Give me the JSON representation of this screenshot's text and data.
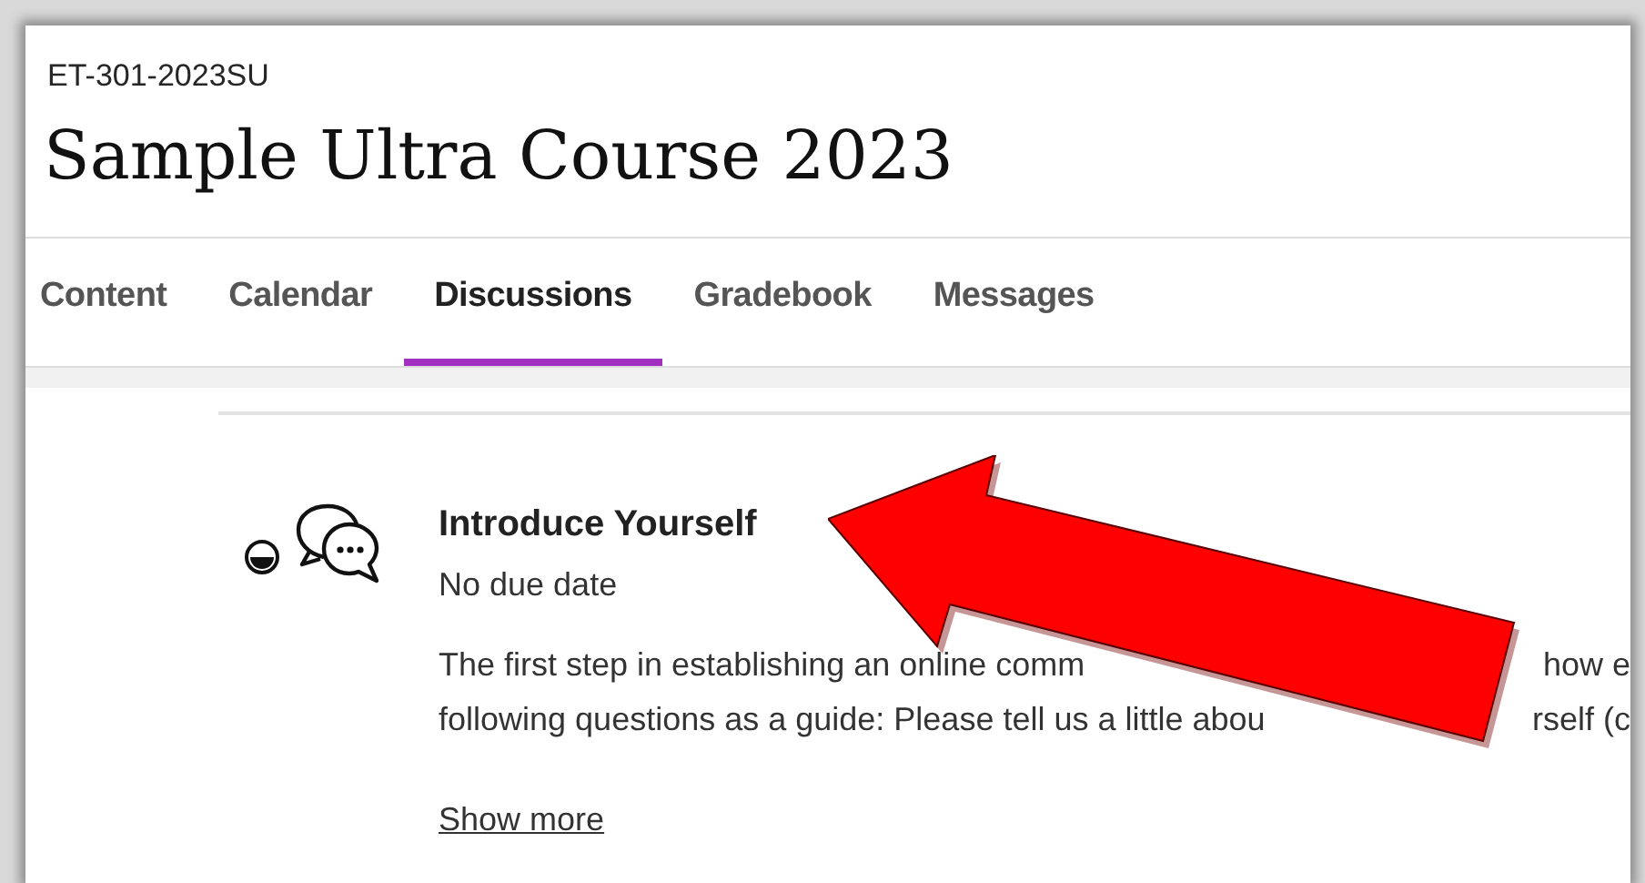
{
  "course_code": "ET-301-2023SU",
  "course_title": "Sample Ultra Course 2023",
  "tabs": [
    {
      "label": "Content",
      "selected": false
    },
    {
      "label": "Calendar",
      "selected": false
    },
    {
      "label": "Discussions",
      "selected": true
    },
    {
      "label": "Gradebook",
      "selected": false
    },
    {
      "label": "Messages",
      "selected": false
    }
  ],
  "discussion": {
    "title": "Introduce Yourself",
    "due": "No due date",
    "description_lines": [
      {
        "left": "The first step in establishing an online comm",
        "right": "how e"
      },
      {
        "left": "following questions as a guide: Please tell us a little abou",
        "right": "rself (c"
      }
    ],
    "show_more": "Show more"
  }
}
